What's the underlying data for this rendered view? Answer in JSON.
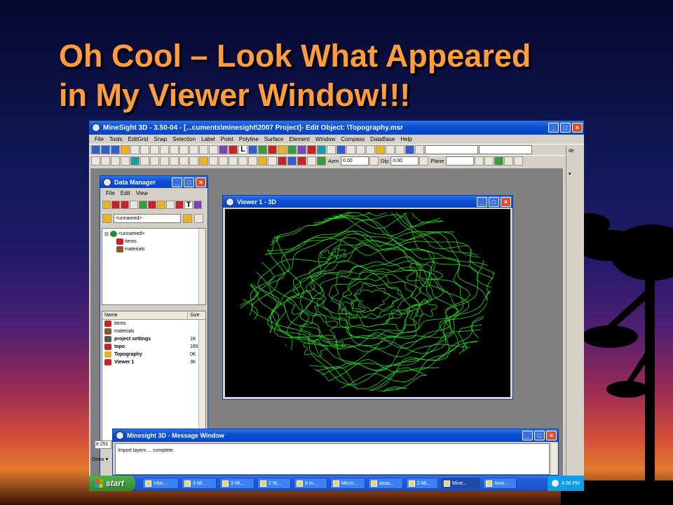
{
  "slide": {
    "title_line1": "Oh Cool – Look What Appeared",
    "title_line2": "in My Viewer Window!!!"
  },
  "app": {
    "title": "MineSight 3D - 3.50-04 - [...cuments\\minesight\\2007 Project]- Edit Object: \\Topography.msr",
    "menu": [
      "File",
      "Tools",
      "EditGrid",
      "Snap",
      "Selection",
      "Label",
      "Point",
      "Polyline",
      "Surface",
      "Element",
      "Window",
      "Compass",
      "DataBase",
      "Help"
    ],
    "azm_label": "Azm",
    "azm_value": "0.00",
    "dip_label": "Dip",
    "dip_value": "0.00",
    "plane_label": "Plane"
  },
  "data_manager": {
    "title": "Data Manager",
    "menu": [
      "File",
      "Edit",
      "View"
    ],
    "selector_value": "<unnamed>",
    "tree": {
      "root": "<unnamed>",
      "children": [
        "items",
        "materials"
      ]
    },
    "list_headers": {
      "name": "Name",
      "size": "Size"
    },
    "rows": [
      {
        "name": "items",
        "size": "",
        "bold": false,
        "color": "#c4252a"
      },
      {
        "name": "materials",
        "size": "",
        "bold": false,
        "color": "#8a5a2a"
      },
      {
        "name": "project settings",
        "size": "1K",
        "bold": true,
        "color": "#555555"
      },
      {
        "name": "topo",
        "size": "165",
        "bold": true,
        "color": "#c4252a"
      },
      {
        "name": "Topography",
        "size": "0K",
        "bold": true,
        "color": "#e7b325"
      },
      {
        "name": "Viewer 1",
        "size": "3K",
        "bold": true,
        "color": "#c4252a"
      }
    ]
  },
  "viewer": {
    "title": "Viewer 1 - 3D",
    "contour_color": "#22dd22"
  },
  "message_window": {
    "title": "Minesight 3D - Message Window",
    "text": "Import layers ... complete."
  },
  "status_left": "e:251",
  "draw_label": "Draw ▾",
  "taskbar": {
    "start": "start",
    "tasks": [
      "Inbo...",
      "3 Mi...",
      "3 Mi...",
      "2 W...",
      "8 In...",
      "Micro...",
      "assa...",
      "2 Mi...",
      "Mine...",
      "Auto..."
    ],
    "active_index": 8,
    "clock": "4:06 PM"
  },
  "colors": {
    "title_orange": "#ff9d3c",
    "xp_blue": "#0a4fd1"
  }
}
